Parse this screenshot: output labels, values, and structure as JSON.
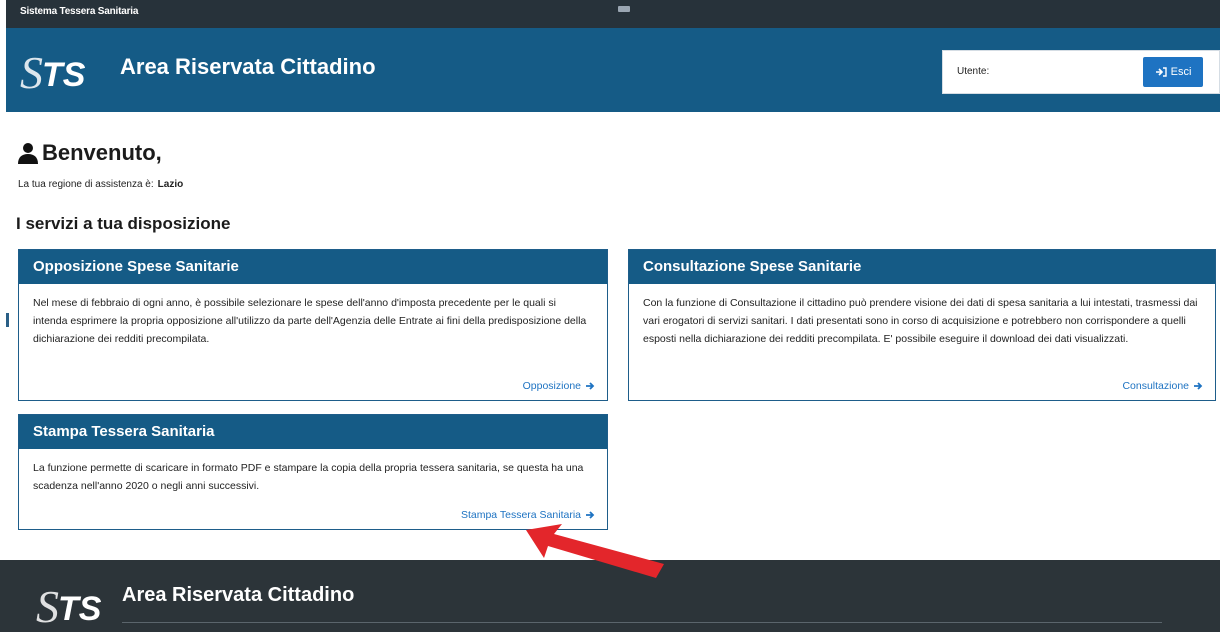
{
  "topbar": {
    "system_name": "Sistema Tessera Sanitaria"
  },
  "header": {
    "logo_text": "STS",
    "title": "Area Riservata Cittadino",
    "user_label": "Utente:",
    "logout_label": "Esci"
  },
  "welcome": {
    "heading": "Benvenuto,",
    "region_label": "La tua regione di assistenza è:",
    "region_value": "Lazio"
  },
  "services": {
    "title": "I servizi a tua disposizione",
    "cards": [
      {
        "title": "Opposizione Spese Sanitarie",
        "text": "Nel mese di febbraio di ogni anno, è possibile selezionare le spese dell'anno d'imposta precedente per le quali si intenda esprimere la propria opposizione all'utilizzo da parte dell'Agenzia delle Entrate ai fini della predisposizione della dichiarazione dei redditi precompilata.",
        "link": "Opposizione"
      },
      {
        "title": "Consultazione Spese Sanitarie",
        "text": "Con la funzione di Consultazione il cittadino può prendere visione dei dati di spesa sanitaria a lui intestati, trasmessi dai vari erogatori di servizi sanitari. I dati presentati sono in corso di acquisizione e potrebbero non corrispondere a quelli esposti nella dichiarazione dei redditi precompilata. E' possibile eseguire il download dei dati visualizzati.",
        "link": "Consultazione"
      },
      {
        "title": "Stampa Tessera Sanitaria",
        "text": "La funzione permette di scaricare in formato PDF e stampare la copia della propria tessera sanitaria, se questa ha una scadenza nell'anno 2020 o negli anni successivi.",
        "link": "Stampa Tessera Sanitaria"
      }
    ]
  },
  "footer": {
    "title": "Area Riservata Cittadino"
  },
  "colors": {
    "primary": "#155b86",
    "link": "#1e73c2",
    "dark": "#27323a",
    "arrow": "#e3262b"
  }
}
